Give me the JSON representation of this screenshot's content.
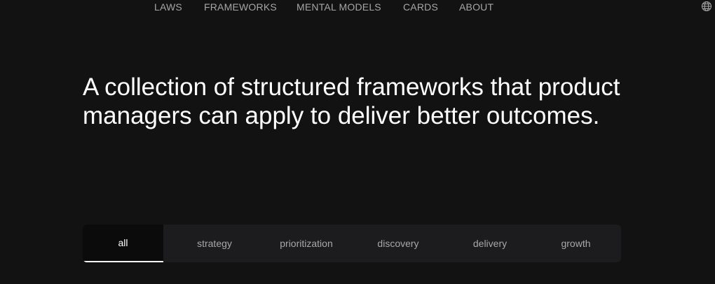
{
  "nav": {
    "items": [
      {
        "label": "LAWS"
      },
      {
        "label": "FRAMEWORKS"
      },
      {
        "label": "MENTAL MODELS"
      },
      {
        "label": "CARDS"
      },
      {
        "label": "ABOUT"
      }
    ],
    "language_icon": "globe-icon"
  },
  "hero": {
    "text": "A collection of structured frameworks that product managers can apply to deliver better outcomes."
  },
  "tabs": {
    "active": "all",
    "items": [
      {
        "label": "all"
      },
      {
        "label": "strategy"
      },
      {
        "label": "prioritization"
      },
      {
        "label": "discovery"
      },
      {
        "label": "delivery"
      },
      {
        "label": "growth"
      }
    ]
  },
  "colors": {
    "background": "#121212",
    "nav_text": "#a6a6a6",
    "tab_bar": "#1c1c1e",
    "tab_active": "#0b0b0b",
    "text": "#ffffff"
  }
}
